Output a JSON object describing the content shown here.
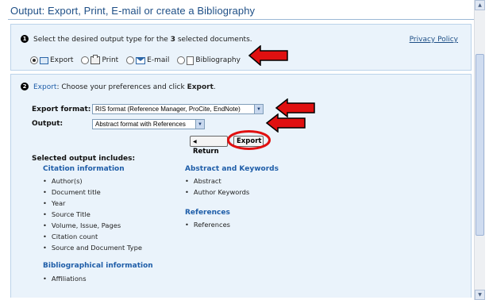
{
  "page": {
    "title": "Output: Export, Print, E-mail or create a Bibliography"
  },
  "step1": {
    "number": "1",
    "instruction_prefix": "Select the desired output type for the ",
    "doc_count": "3",
    "instruction_suffix": " selected documents.",
    "privacy_link": "Privacy Policy",
    "options": [
      {
        "label": "Export",
        "icon": "export-icon",
        "selected": true
      },
      {
        "label": "Print",
        "icon": "printer-icon",
        "selected": false
      },
      {
        "label": "E-mail",
        "icon": "email-icon",
        "selected": false
      },
      {
        "label": "Bibliography",
        "icon": "bibliography-icon",
        "selected": false
      }
    ]
  },
  "step2": {
    "number": "2",
    "heading_link": "Export",
    "instruction_a": ": Choose your preferences and click ",
    "instruction_b": "Export",
    "instruction_c": ".",
    "export_format_label": "Export format:",
    "export_format_value": "RIS format (Reference Manager, ProCite, EndNote)",
    "output_label": "Output:",
    "output_value": "Abstract format with References",
    "return_button": "Return",
    "export_button": "Export",
    "includes_heading": "Selected output includes:",
    "citation_title": "Citation information",
    "citation_items": [
      "Author(s)",
      "Document title",
      "Year",
      "Source Title",
      "Volume, Issue, Pages",
      "Citation count",
      "Source and Document Type"
    ],
    "biblio_title": "Bibliographical information",
    "biblio_items": [
      "Affiliations"
    ],
    "abstract_title": "Abstract and Keywords",
    "abstract_items": [
      "Abstract",
      "Author Keywords"
    ],
    "references_title": "References",
    "references_items": [
      "References"
    ]
  },
  "colors": {
    "accent": "#1e5da8",
    "annotation_red": "#e01010",
    "panel_bg": "#eaf3fb"
  }
}
